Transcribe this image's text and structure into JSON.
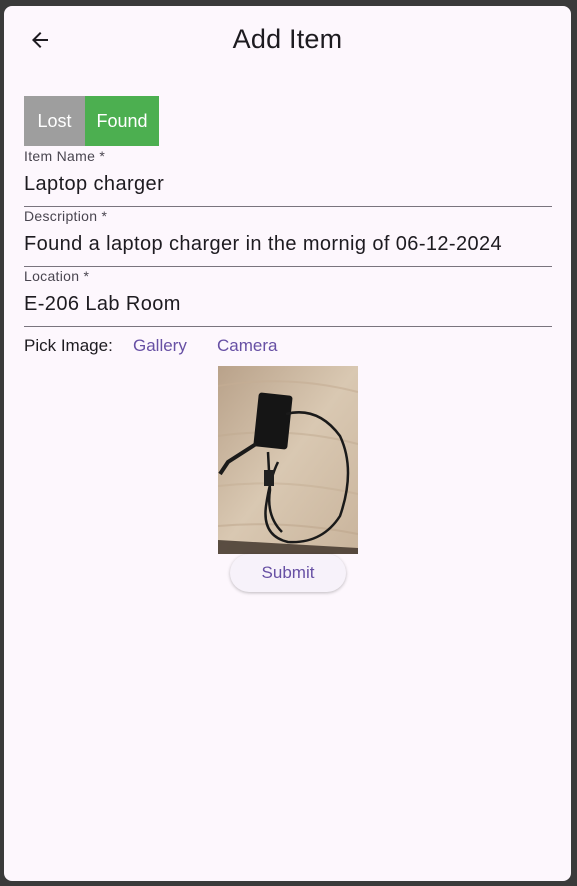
{
  "appbar": {
    "title": "Add Item",
    "back_icon": "arrow-left-icon"
  },
  "toggle": {
    "lost_label": "Lost",
    "found_label": "Found",
    "selected": "Found",
    "lost_color": "#9e9e9e",
    "found_color": "#4caf50"
  },
  "form": {
    "item_name": {
      "label": "Item Name *",
      "value": "Laptop charger"
    },
    "description": {
      "label": "Description *",
      "value": "Found a laptop charger in the mornig of 06-12-2024"
    },
    "location": {
      "label": "Location *",
      "value": "E-206 Lab Room"
    }
  },
  "pick_image": {
    "label": "Pick Image:",
    "gallery_label": "Gallery",
    "camera_label": "Camera"
  },
  "submit_label": "Submit",
  "colors": {
    "background": "#fdf7fd",
    "primary": "#6750a4"
  }
}
